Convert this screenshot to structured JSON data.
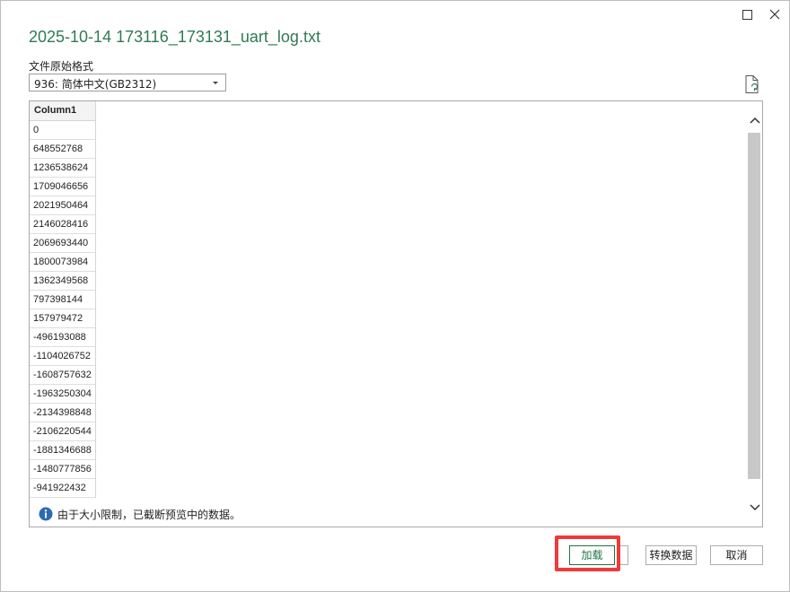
{
  "window": {
    "title": "2025-10-14 173116_173131_uart_log.txt"
  },
  "encoding": {
    "label": "文件原始格式",
    "selected": "936: 简体中文(GB2312)"
  },
  "table": {
    "header": "Column1",
    "rows": [
      "0",
      "648552768",
      "1236538624",
      "1709046656",
      "2021950464",
      "2146028416",
      "2069693440",
      "1800073984",
      "1362349568",
      "797398144",
      "157979472",
      "-496193088",
      "-1104026752",
      "-1608757632",
      "-1963250304",
      "-2134398848",
      "-2106220544",
      "-1881346688",
      "-1480777856",
      "-941922432"
    ]
  },
  "info": {
    "message": "由于大小限制，已截断预览中的数据。"
  },
  "buttons": {
    "load": "加载",
    "transform": "转换数据",
    "cancel": "取消"
  },
  "colors": {
    "title": "#2f7a55",
    "accent": "#217346",
    "highlight": "#f03a3a",
    "info_icon": "#2b6cb0"
  }
}
